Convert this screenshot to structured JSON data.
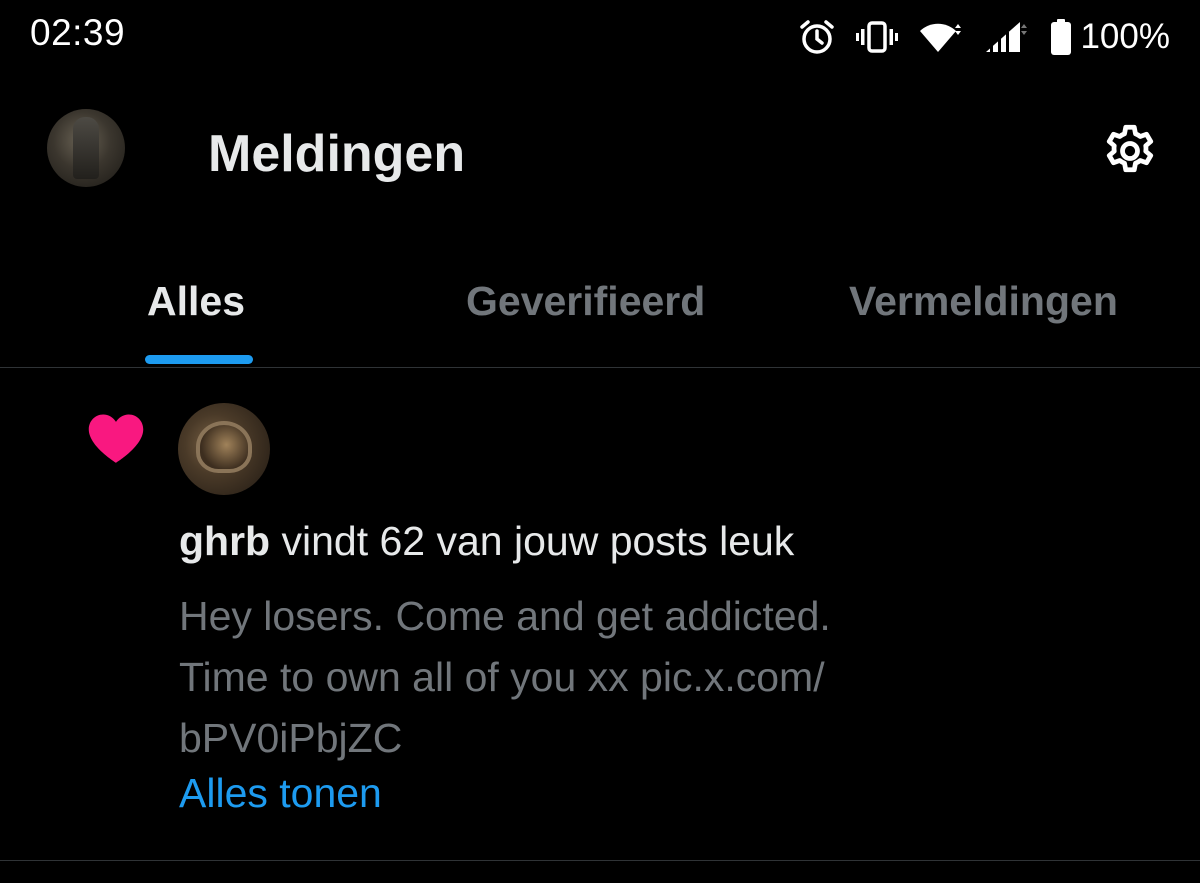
{
  "status_bar": {
    "time": "02:39",
    "battery": "100%",
    "icons": [
      "alarm-icon",
      "vibrate-icon",
      "wifi-icon",
      "signal-icon",
      "battery-icon"
    ]
  },
  "header": {
    "title": "Meldingen",
    "settings_icon": "gear-icon"
  },
  "tabs": [
    {
      "label": "Alles",
      "active": true
    },
    {
      "label": "Geverifieerd",
      "active": false
    },
    {
      "label": "Vermeldingen",
      "active": false
    }
  ],
  "notification": {
    "icon": "heart-icon",
    "username": "ghrb",
    "action_text": "vindt 62 van jouw posts leuk",
    "post_lines": [
      "Hey losers. Come and get addicted.",
      "Time to own all of you xx pic.x.com/",
      "bPV0iPbjZC"
    ],
    "show_all": "Alles tonen"
  },
  "colors": {
    "background": "#000000",
    "text_primary": "#e7e9ea",
    "text_secondary": "#71767b",
    "accent": "#1d9bf0",
    "like": "#f91880",
    "divider": "#2f3336"
  }
}
